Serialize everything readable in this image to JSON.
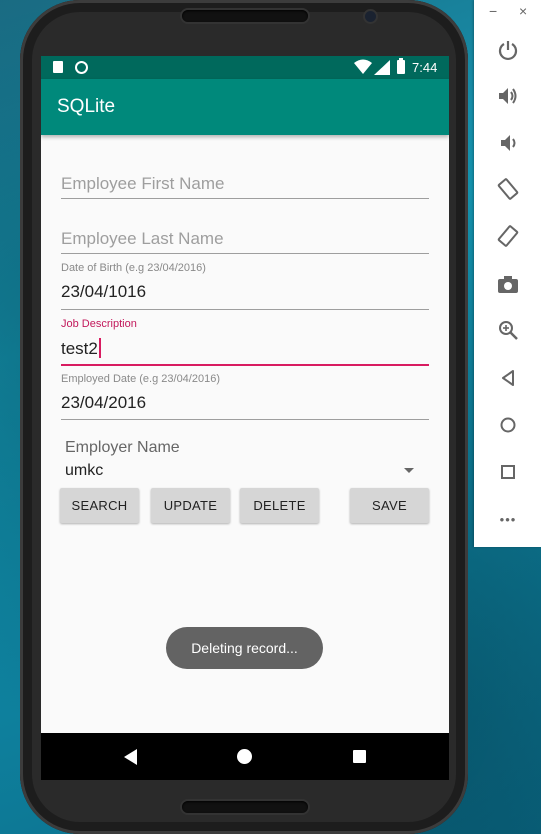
{
  "status_bar": {
    "time": "7:44"
  },
  "app": {
    "title": "SQLite"
  },
  "form": {
    "first_name_placeholder": "Employee First Name",
    "last_name_placeholder": "Employee Last Name",
    "dob_label": "Date of Birth (e.g 23/04/2016)",
    "dob_value": "23/04/1016",
    "job_label": "Job Description",
    "job_value": "test2",
    "employed_label": "Employed Date (e.g 23/04/2016)",
    "employed_value": "23/04/2016",
    "employer_label": "Employer Name",
    "employer_value": "umkc"
  },
  "buttons": {
    "search": "SEARCH",
    "update": "UPDATE",
    "delete": "DELETE",
    "save": "SAVE"
  },
  "toast": {
    "message": "Deleting record..."
  },
  "emulator": {
    "minimize_label": "−",
    "close_label": "×",
    "more_label": "•••"
  },
  "colors": {
    "status_bar": "#00695c",
    "app_bar": "#00897b",
    "focus_accent": "#d81b60"
  }
}
